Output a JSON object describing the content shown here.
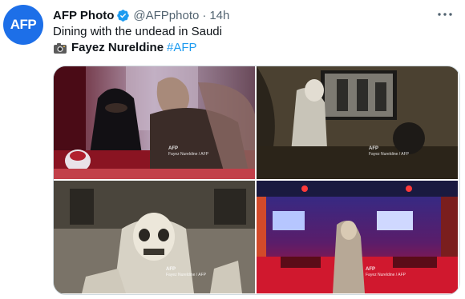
{
  "tweet": {
    "avatar_text": "AFP",
    "author_name": "AFP Photo",
    "handle": "@AFPphoto",
    "separator": "·",
    "time": "14h",
    "more_icon": "ellipsis-icon",
    "text_line1": "Dining with the undead in Saudi",
    "photographer": "Fayez Nureldine",
    "hashtag": "#AFP",
    "brand_color": "#1d9bf0"
  },
  "photos": [
    {
      "watermark_brand": "AFP",
      "watermark_credit": "Fayez Nureldine / AFP"
    },
    {
      "watermark_brand": "AFP",
      "watermark_credit": "Fayez Nureldine / AFP"
    },
    {
      "watermark_brand": "AFP",
      "watermark_credit": "Fayez Nureldine / AFP"
    },
    {
      "watermark_brand": "AFP",
      "watermark_credit": "Fayez Nureldine / AFP"
    }
  ]
}
